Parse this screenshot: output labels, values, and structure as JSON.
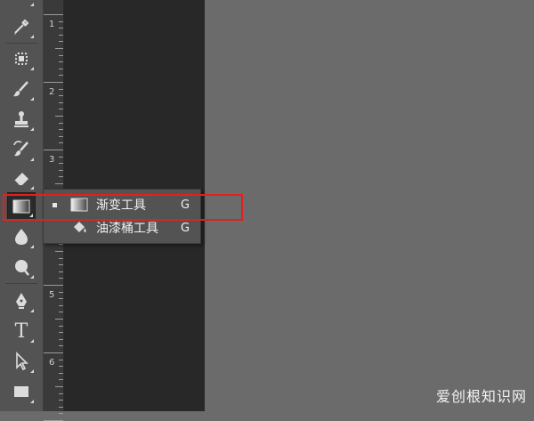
{
  "toolbar": {
    "tools": [
      {
        "name": "eyedropper-tool"
      },
      {
        "name": "healing-brush-tool"
      },
      {
        "name": "brush-tool"
      },
      {
        "name": "clone-stamp-tool"
      },
      {
        "name": "history-brush-tool"
      },
      {
        "name": "eraser-tool"
      },
      {
        "name": "gradient-tool"
      },
      {
        "name": "blur-tool"
      },
      {
        "name": "dodge-tool"
      },
      {
        "name": "pen-tool"
      },
      {
        "name": "type-tool",
        "glyph": "T"
      },
      {
        "name": "path-selection-tool"
      },
      {
        "name": "rectangle-tool"
      }
    ]
  },
  "ruler": {
    "numbers": [
      "1",
      "2",
      "3",
      "4",
      "5",
      "6"
    ]
  },
  "flyout": {
    "items": [
      {
        "label": "渐变工具",
        "shortcut": "G",
        "selected": true,
        "icon": "gradient-icon"
      },
      {
        "label": "油漆桶工具",
        "shortcut": "G",
        "selected": false,
        "icon": "paint-bucket-icon"
      }
    ]
  },
  "watermark": "爱创根知识网",
  "colors": {
    "highlight": "#e0211f",
    "toolbar": "#535353",
    "canvas_dark": "#282828",
    "canvas_gray": "#6b6b6b"
  }
}
